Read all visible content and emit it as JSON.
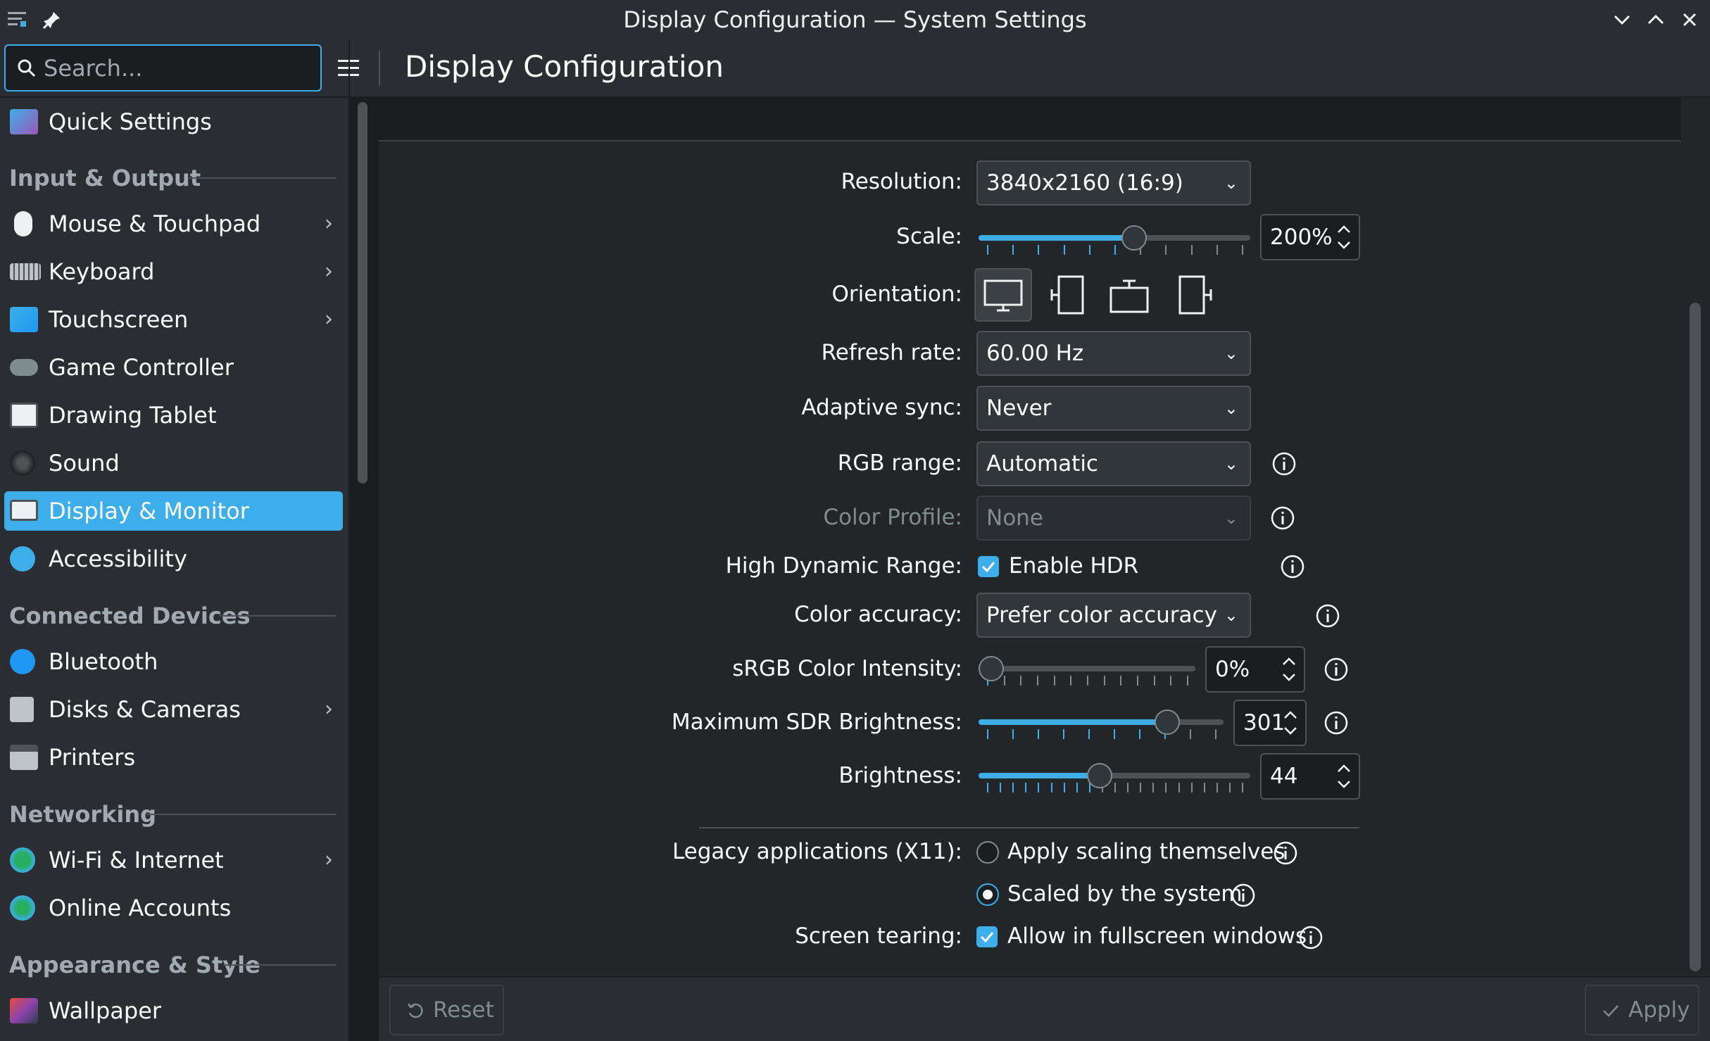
{
  "window": {
    "title": "Display Configuration — System Settings"
  },
  "search": {
    "placeholder": "Search..."
  },
  "page_title": "Display Configuration",
  "sidebar": {
    "items": [
      {
        "label": "Quick Settings"
      },
      {
        "section": "Input & Output"
      },
      {
        "label": "Mouse & Touchpad",
        "chevron": true
      },
      {
        "label": "Keyboard",
        "chevron": true
      },
      {
        "label": "Touchscreen",
        "chevron": true
      },
      {
        "label": "Game Controller"
      },
      {
        "label": "Drawing Tablet"
      },
      {
        "label": "Sound"
      },
      {
        "label": "Display & Monitor",
        "active": true
      },
      {
        "label": "Accessibility"
      },
      {
        "section": "Connected Devices"
      },
      {
        "label": "Bluetooth"
      },
      {
        "label": "Disks & Cameras",
        "chevron": true
      },
      {
        "label": "Printers"
      },
      {
        "section": "Networking"
      },
      {
        "label": "Wi-Fi & Internet",
        "chevron": true
      },
      {
        "label": "Online Accounts"
      },
      {
        "section": "Appearance & Style"
      },
      {
        "label": "Wallpaper"
      }
    ]
  },
  "settings": {
    "resolution": {
      "label": "Resolution:",
      "value": "3840x2160 (16:9)"
    },
    "scale": {
      "label": "Scale:",
      "value": "200%",
      "level": 0.58
    },
    "orientation": {
      "label": "Orientation:",
      "selected": "landscape"
    },
    "refresh_rate": {
      "label": "Refresh rate:",
      "value": "60.00 Hz"
    },
    "adaptive_sync": {
      "label": "Adaptive sync:",
      "value": "Never"
    },
    "rgb_range": {
      "label": "RGB range:",
      "value": "Automatic"
    },
    "color_profile": {
      "label": "Color Profile:",
      "value": "None",
      "disabled": true
    },
    "hdr": {
      "label": "High Dynamic Range:",
      "option": "Enable HDR",
      "checked": true
    },
    "color_accuracy": {
      "label": "Color accuracy:",
      "value": "Prefer color accuracy"
    },
    "srgb_intensity": {
      "label": "sRGB Color Intensity:",
      "value": "0%",
      "level": 0.0
    },
    "max_sdr_brightness": {
      "label": "Maximum SDR Brightness:",
      "value": "301",
      "level": 0.8
    },
    "brightness": {
      "label": "Brightness:",
      "value": "44",
      "level": 0.44
    },
    "legacy_apps": {
      "label": "Legacy applications (X11):",
      "option1": "Apply scaling themselves",
      "option2": "Scaled by the system",
      "selected": 2
    },
    "screen_tearing": {
      "label": "Screen tearing:",
      "option": "Allow in fullscreen windows",
      "checked": true
    }
  },
  "buttons": {
    "reset": "Reset",
    "apply": "Apply"
  },
  "colors": {
    "accent": "#3daee9",
    "window_bg": "#2a2e32",
    "view_bg": "#232629"
  }
}
